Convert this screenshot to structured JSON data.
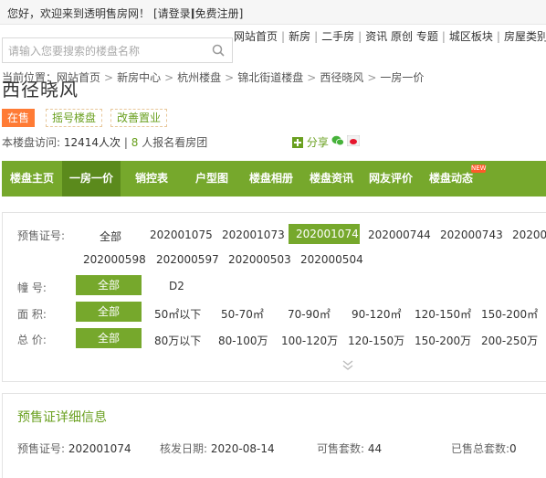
{
  "topbar": {
    "greeting": "您好，欢迎来到透明售房网！",
    "login": "[请登录]",
    "register": "[免费注册]"
  },
  "search": {
    "placeholder": "请输入您要搜索的楼盘名称"
  },
  "sitenav": [
    "网站首页",
    "新房",
    "二手房",
    "资讯 原创 专题",
    "城区板块",
    "房屋类别"
  ],
  "breadcrumb": [
    "当前位置：网站首页",
    "新房中心",
    "杭州楼盘",
    "锦北街道楼盘",
    "西径晓风",
    "一房一价"
  ],
  "title": "西径晓风",
  "tags": {
    "status": "在售",
    "t1": "摇号楼盘",
    "t2": "改善置业"
  },
  "visits": {
    "label": "本楼盘访问:",
    "count": "12414人次",
    "sep": "|",
    "signup_count": "8",
    "signup_text": "人报名看房团",
    "share": "分享"
  },
  "mainnav": [
    "楼盘主页",
    "一房一价",
    "销控表",
    "户型图",
    "楼盘相册",
    "楼盘资讯",
    "网友评价",
    "楼盘动态"
  ],
  "mainnav_badge": "NEW",
  "filters": {
    "presale": {
      "label": "预售证号:",
      "row1": [
        "全部",
        "202001075",
        "202001073",
        "202001074",
        "202000744",
        "202000743",
        "202000"
      ],
      "row2": [
        "202000598",
        "202000597",
        "202000503",
        "202000504"
      ]
    },
    "building": {
      "label": "幢    号:",
      "options": [
        "全部",
        "D2"
      ]
    },
    "area": {
      "label": "面    积:",
      "options": [
        "全部",
        "50㎡以下",
        "50-70㎡",
        "70-90㎡",
        "90-120㎡",
        "120-150㎡",
        "150-200㎡"
      ]
    },
    "price": {
      "label": "总    价:",
      "options": [
        "全部",
        "80万以下",
        "80-100万",
        "100-120万",
        "120-150万",
        "150-200万",
        "200-250万"
      ]
    }
  },
  "detail": {
    "title": "预售证详细信息",
    "presale_label": "预售证号:",
    "presale_value": "202001074",
    "issue_label": "核发日期:",
    "issue_value": "2020-08-14",
    "available_label": "可售套数:",
    "available_value": "44",
    "sold_label": "已售总套数:",
    "sold_value": "0"
  },
  "colors": {
    "accent_green": "#76a82c",
    "sale_orange": "#ff7b35"
  }
}
